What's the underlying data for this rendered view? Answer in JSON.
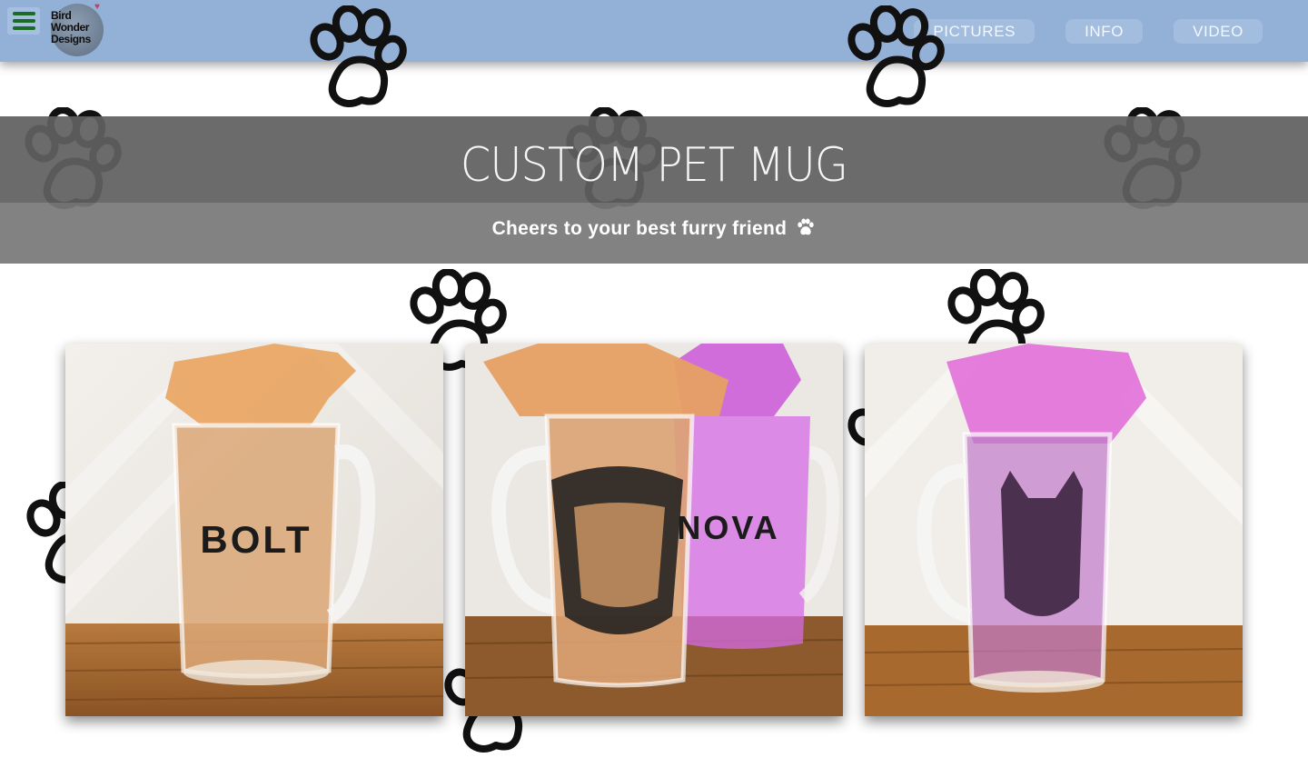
{
  "nav": {
    "menu_icon": "hamburger-menu-icon",
    "logo_text": "Bird\nWonder\nDesigns",
    "links": [
      "PICTURES",
      "INFO",
      "VIDEO"
    ]
  },
  "hero": {
    "title": "CUSTOM PET MUG",
    "subtitle": "Cheers to your best furry friend",
    "subtitle_icon": "paw-icon"
  },
  "gallery": {
    "items": [
      {
        "mug_text": "BOLT",
        "tissue": "orange"
      },
      {
        "mug_text": "NOVA",
        "tissue": "orange-and-pink"
      },
      {
        "mug_text": "",
        "tissue": "pink"
      }
    ]
  },
  "colors": {
    "navbar": "#93b0d6",
    "menu_icon": "#1a6b24",
    "hero_band": "#606060",
    "hero_sub_band": "#787878"
  }
}
